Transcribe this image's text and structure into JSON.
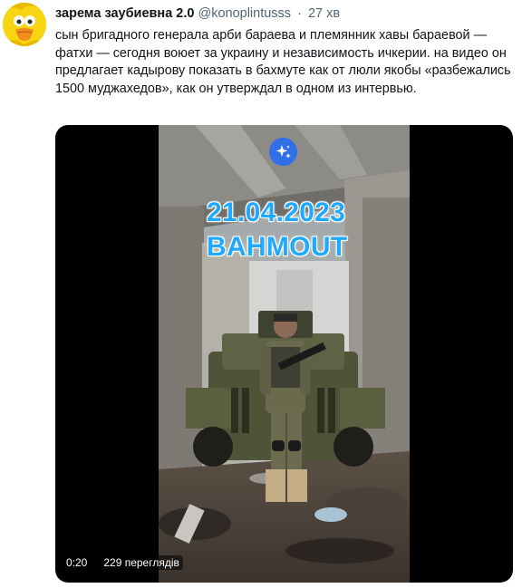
{
  "tweet": {
    "author_name": "зарема заубиевна 2.0",
    "author_handle": "@konoplintusss",
    "separator": "·",
    "time": "27 хв",
    "text": "сын бригадного генерала арби бараева и племянник хавы бараевой — фатхи — сегодня воюет за украину и независимость ичкерии. на видео он предлагает кадырову показать в бахмуте как от люли якобы «разбежались 1500 муджахедов», как он утверждал в одном из интервью."
  },
  "video": {
    "overlay_date": "21.04.2023",
    "overlay_place": "BAHMOUT",
    "duration": "0:20",
    "views": "229 переглядів",
    "sparkle_icon": "sparkle-icon"
  },
  "colors": {
    "overlay_text": "#1faaff",
    "sparkle_button": "#2f6fe8",
    "avatar_bg": "#f5d000"
  }
}
